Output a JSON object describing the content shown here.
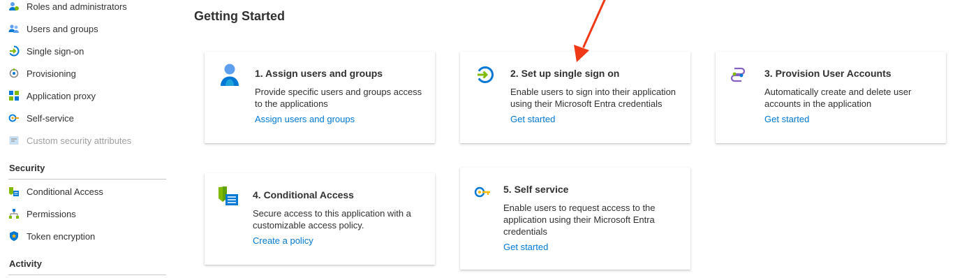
{
  "sidebar": {
    "items": [
      {
        "label": "Roles and administrators",
        "icon": "roles-icon"
      },
      {
        "label": "Users and groups",
        "icon": "users-icon"
      },
      {
        "label": "Single sign-on",
        "icon": "sso-icon"
      },
      {
        "label": "Provisioning",
        "icon": "provisioning-icon"
      },
      {
        "label": "Application proxy",
        "icon": "app-proxy-icon"
      },
      {
        "label": "Self-service",
        "icon": "self-service-icon"
      },
      {
        "label": "Custom security attributes",
        "icon": "custom-attributes-icon"
      }
    ],
    "security_header": "Security",
    "security_items": [
      {
        "label": "Conditional Access",
        "icon": "conditional-access-icon"
      },
      {
        "label": "Permissions",
        "icon": "permissions-icon"
      },
      {
        "label": "Token encryption",
        "icon": "shield-icon"
      }
    ],
    "activity_header": "Activity"
  },
  "main": {
    "title": "Getting Started",
    "cards": [
      {
        "title": "1. Assign users and groups",
        "desc1": "Provide specific users and groups access",
        "desc2": "to the applications",
        "desc3": "",
        "link": "Assign users and groups"
      },
      {
        "title": "2. Set up single sign on",
        "desc1": "Enable users to sign into their application",
        "desc2": "using their Microsoft Entra credentials",
        "desc3": "",
        "link": "Get started"
      },
      {
        "title": "3. Provision User Accounts",
        "desc1": "Automatically create and delete user",
        "desc2": "accounts in the application",
        "desc3": "",
        "link": "Get started"
      },
      {
        "title": "4. Conditional Access",
        "desc1": "Secure access to this application with a",
        "desc2": "customizable access policy.",
        "desc3": "",
        "link": "Create a policy"
      },
      {
        "title": "5. Self service",
        "desc1": "Enable users to request access to the",
        "desc2": "application using their Microsoft Entra",
        "desc3": "credentials",
        "link": "Get started"
      }
    ]
  },
  "colors": {
    "link": "#0078d4",
    "annotation_arrow": "#f03a17"
  }
}
